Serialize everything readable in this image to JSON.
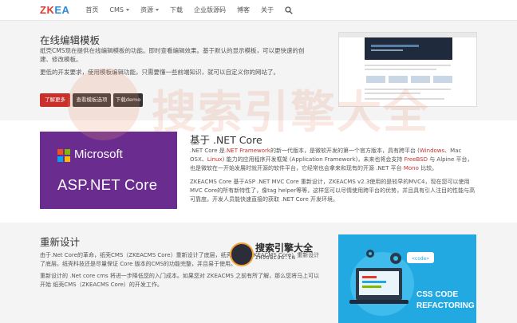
{
  "logo": {
    "part1": "ZK",
    "part2": "EA"
  },
  "nav": {
    "items": [
      {
        "label": "首页",
        "dropdown": false
      },
      {
        "label": "CMS",
        "dropdown": true
      },
      {
        "label": "资源",
        "dropdown": true
      },
      {
        "label": "下载",
        "dropdown": false
      },
      {
        "label": "企业版源码",
        "dropdown": false
      },
      {
        "label": "博客",
        "dropdown": false
      },
      {
        "label": "关于",
        "dropdown": false
      }
    ],
    "search_icon": "search-icon"
  },
  "section1": {
    "title": "在线编辑模板",
    "p1": "纸壳CMS现在提供在线编辑模板的功能。即时查看编辑效果。基于默认的显示模板，可以更快速的创建、修改模板。",
    "p2": "更低的开发要求，使用模板编辑功能，只需要懂一些前端知识，就可以自定义你的网站了。",
    "buttons": [
      "了解更多",
      "查看模板选项",
      "下载demo"
    ]
  },
  "section2": {
    "title": "基于 .NET Core",
    "image": {
      "brand": "Microsoft",
      "product": "ASP.NET Core"
    },
    "p1": {
      "t1": ".NET Core 是",
      "k1": ".NET Framework",
      "t2": "的新一代版本，是微软开发的第一个官方版本，具有跨平台 (",
      "k2": "Windows",
      "t3": "、Mac OSX、",
      "k3": "Linux",
      "t4": ") 能力的应用程序开发框架 (Application Framework)，未来也将会支持 ",
      "k4": "FreeBSD",
      "t5": " 与 Alpine 平台，也是微软在一开始发展时就开源的软件平台，它经常也会拿来和现有的开源 .NET 平台 ",
      "k5": "Mono",
      "t6": " 比较。"
    },
    "p2": "ZKEACMS Core 基于ASP .NET MVC Core 重新设计，ZKEACMS v2.3使用的是较早的MVC4，现在您可以使用MVC Core的所有新特性了，像tag helper等等，这样您可以尽情使用跨平台的优势，并且具有引人注目的性能与高可靠度。开发人员能快速直接的获取 .NET Core 开发环境。"
  },
  "section3": {
    "title": "重新设计",
    "p1": "由于.Net Core的革命，纸壳CMS（ZKEACMS Core）重新设计了底层，纸壳CMS（ZKEACMS Core）重新设计了底层。纸壳科技还是尽量保证 Core 版本的CMS的功能完整，并且易于使用。",
    "p2": "重新设计的 .Net core cms 将进一步降低您的入门成本。如果您对 ZKEACMS 之前有所了解，那么您将马上可以开始 纸壳CMS（ZKEACMS Core）的开发工作。",
    "image": {
      "line1": "CSS CODE",
      "line2": "REFACTORING",
      "code_tag": "<code>"
    }
  },
  "watermark": {
    "text": "搜索引擎大全"
  },
  "badge": {
    "main": "搜索引擎大全",
    "sub": "ZHOOBLOG.CN"
  },
  "colors": {
    "brand_red": "#c9302c",
    "dark_button": "#333333",
    "ms_purple": "#6a2d8f",
    "css_blue": "#23a9e1"
  }
}
